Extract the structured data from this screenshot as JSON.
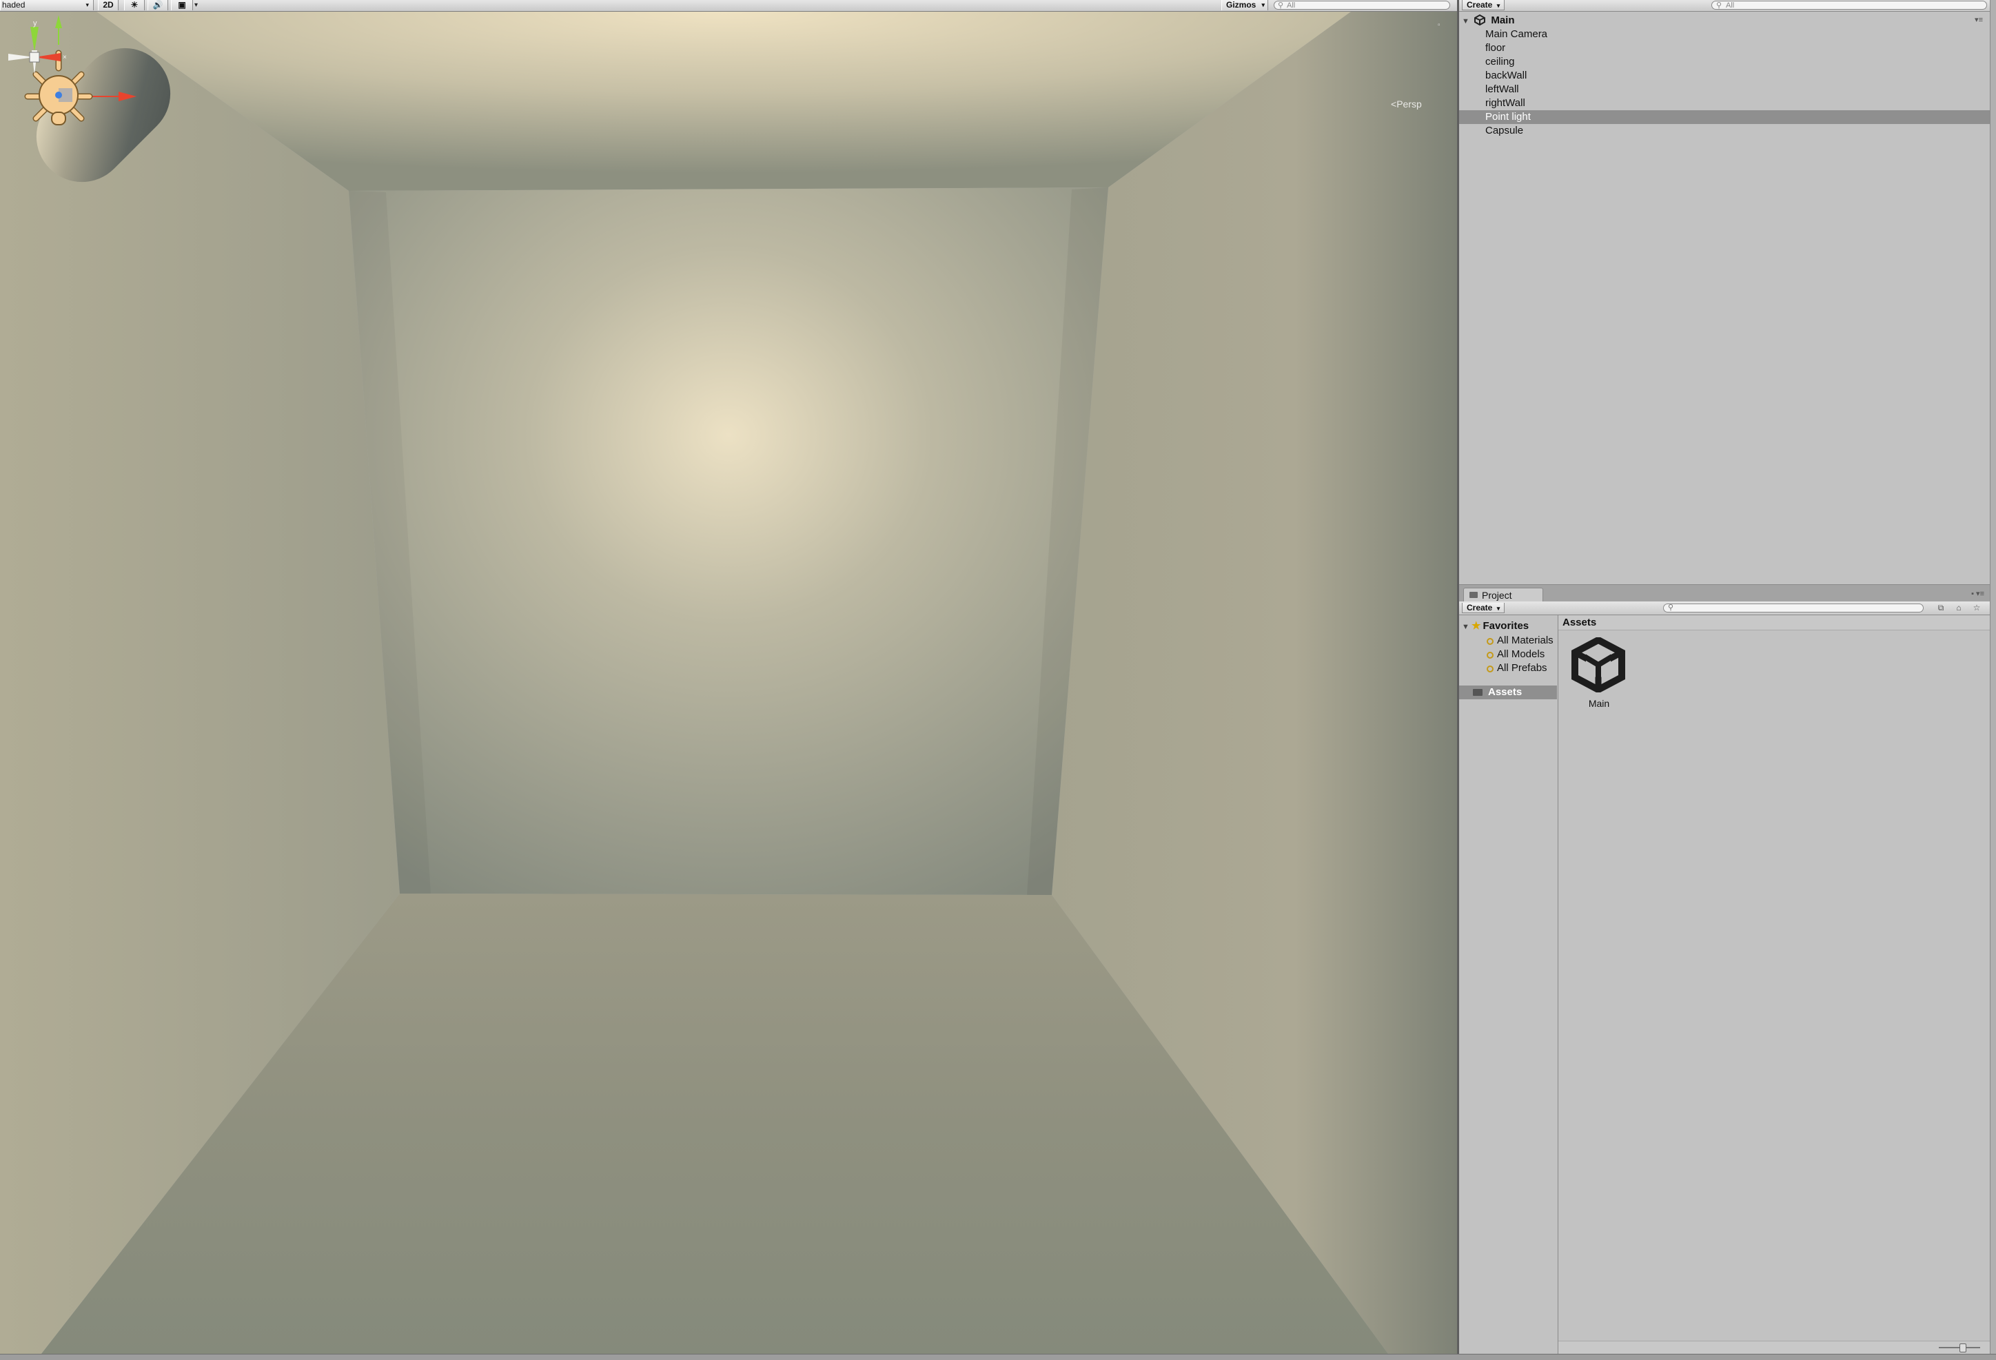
{
  "scene_toolbar": {
    "shading_mode": "haded",
    "btn_2d": "2D",
    "lighting_icon": "sun-icon",
    "audio_icon": "speaker-icon",
    "effects_icon": "image-icon",
    "gizmos_label": "Gizmos",
    "search_placeholder": "All"
  },
  "scene_view": {
    "camera_mode": "Persp",
    "axis_y_label": "y",
    "colors": {
      "light_gizmo": "#f6cd92",
      "axis_x": "#e8442e",
      "axis_y": "#8ed63a",
      "axis_z": "#3f7fe0"
    }
  },
  "hierarchy": {
    "create_label": "Create",
    "search_placeholder": "All",
    "scene_name": "Main",
    "items": [
      {
        "label": "Main Camera"
      },
      {
        "label": "floor"
      },
      {
        "label": "ceiling"
      },
      {
        "label": "backWall"
      },
      {
        "label": "leftWall"
      },
      {
        "label": "rightWall"
      },
      {
        "label": "Point light"
      },
      {
        "label": "Capsule"
      }
    ],
    "selected_item": "Point light"
  },
  "project": {
    "tab_label": "Project",
    "create_label": "Create",
    "favorites_label": "Favorites",
    "favorites": [
      {
        "label": "All Materials"
      },
      {
        "label": "All Models"
      },
      {
        "label": "All Prefabs"
      }
    ],
    "assets_folder": "Assets",
    "breadcrumb": "Assets",
    "assets": [
      {
        "name": "Main",
        "icon": "unity-scene-icon"
      }
    ]
  }
}
